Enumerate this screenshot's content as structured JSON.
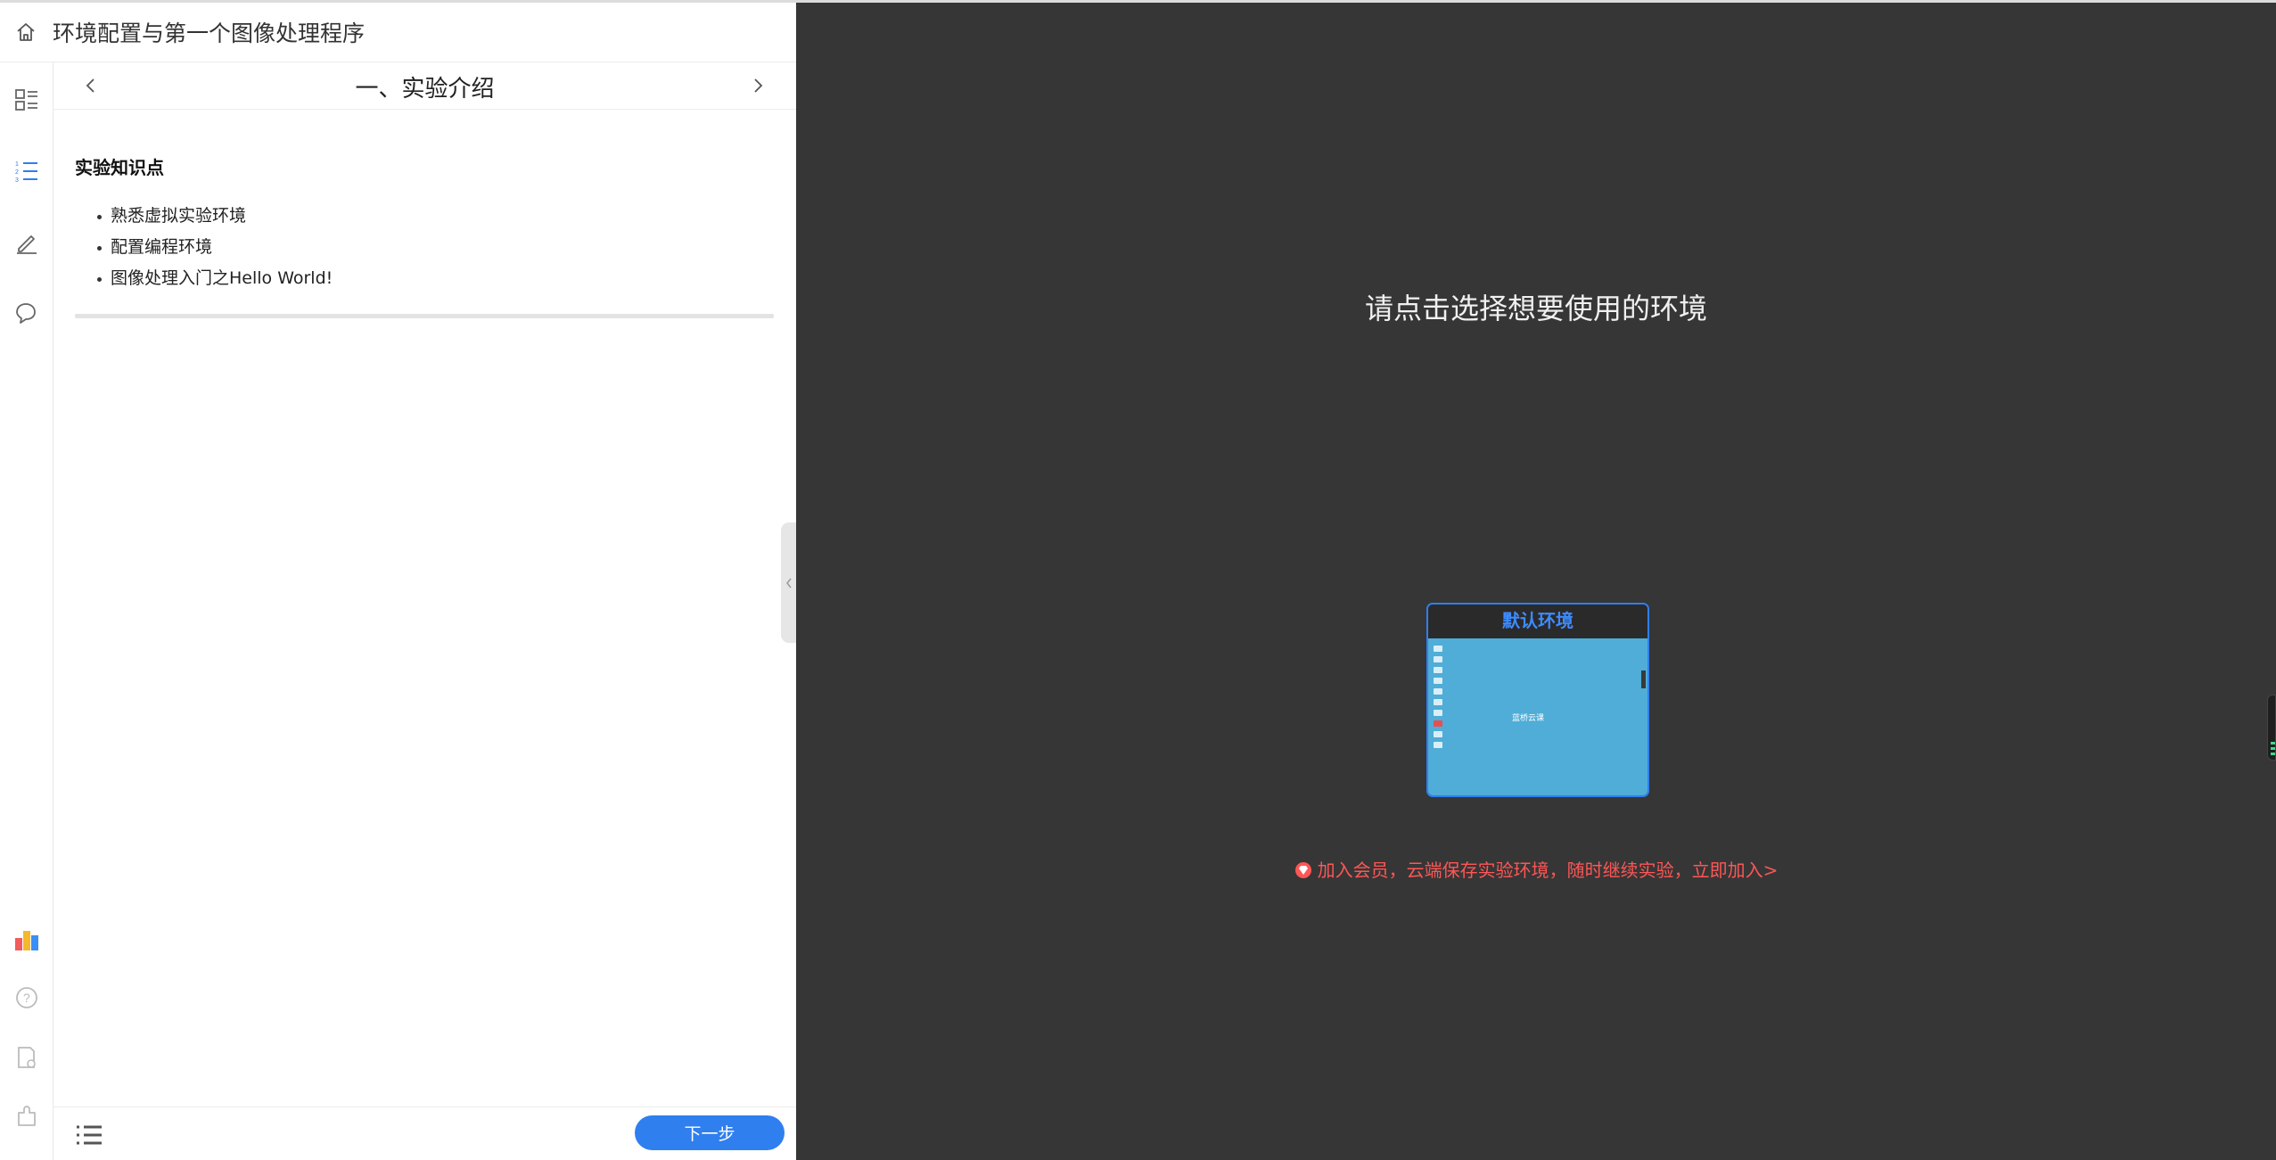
{
  "header": {
    "title": "环境配置与第一个图像处理程序"
  },
  "section": {
    "title": "一、实验介绍"
  },
  "doc": {
    "heading": "实验知识点",
    "items": [
      "熟悉虚拟实验环境",
      "配置编程环境",
      "图像处理入门之Hello World!"
    ]
  },
  "footer": {
    "next_label": "下一步"
  },
  "env_panel": {
    "prompt": "请点击选择想要使用的环境",
    "card_title": "默认环境",
    "thumb_logo": "蓝桥云课",
    "promo": "加入会员，云端保存实验环境，随时继续实验，立即加入>"
  },
  "colors": {
    "accent": "#2f7fef",
    "promo_red": "#ff5656",
    "dark_bg": "#363636",
    "desktop_blue": "#4fadd8"
  },
  "icons": {
    "header": "home-icon",
    "rail": [
      "catalog-icon",
      "numbered-list-icon",
      "pencil-icon",
      "chat-icon",
      "leaderboard-icon",
      "help-icon",
      "report-icon",
      "puzzle-icon"
    ],
    "footer": "list-icon"
  }
}
